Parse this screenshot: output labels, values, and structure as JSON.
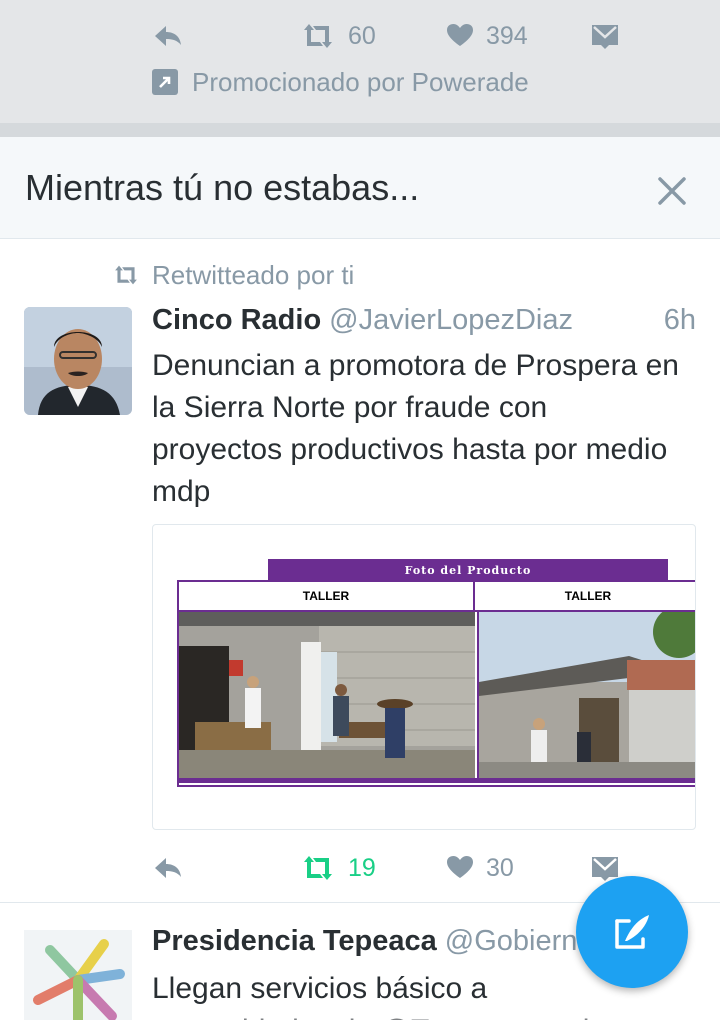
{
  "promoted_tweet": {
    "retweet_count": "60",
    "like_count": "394",
    "promoted_label": "Promocionado por Powerade"
  },
  "while_away": {
    "title": "Mientras tú no estabas..."
  },
  "tweet1": {
    "retweeted_label": "Retwitteado por ti",
    "name": "Cinco Radio",
    "handle": "@JavierLopezDiaz",
    "time": "6h",
    "text": "Denuncian a promotora de Prospera en la Sierra Norte por fraude con proyectos productivos hasta por medio mdp",
    "media": {
      "header": "Foto del Producto",
      "col1_label": "TALLER",
      "col2_label": "TALLER"
    },
    "retweet_count": "19",
    "like_count": "30"
  },
  "tweet2": {
    "name": "Presidencia Tepeaca",
    "handle": "@Gobiern",
    "handle_tail": "n",
    "text_line1": "Llegan servicios básico a",
    "text_line2": "comunidades de @Tepeaca... mi"
  },
  "colors": {
    "accent": "#1da1f2",
    "retweet_active": "#19cf86",
    "muted": "#8899a6",
    "media_purple": "#6b2d91"
  },
  "icons": [
    "reply-icon",
    "retweet-icon",
    "heart-icon",
    "message-icon",
    "promoted-icon",
    "close-icon",
    "compose-icon"
  ]
}
